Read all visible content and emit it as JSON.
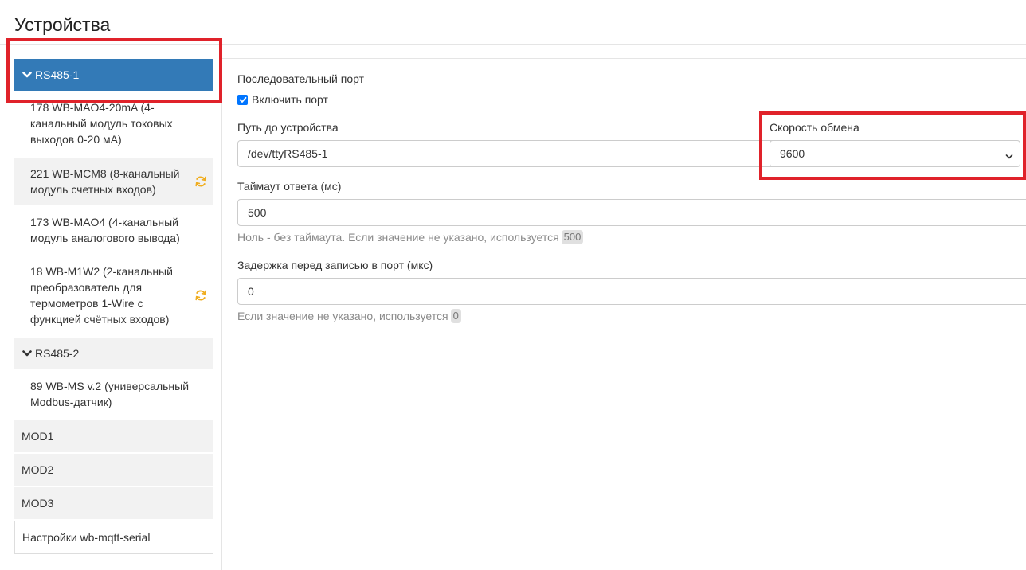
{
  "page": {
    "title": "Устройства"
  },
  "sidebar": {
    "ports": [
      {
        "label": "RS485-1",
        "active": true
      },
      {
        "label": "RS485-2",
        "active": false
      }
    ],
    "devices_rs485_1": [
      {
        "label": "178 WB-MAO4-20mA (4-канальный модуль токовых выходов 0-20 мА)",
        "sync": false
      },
      {
        "label": "221 WB-MCM8 (8-канальный модуль счетных входов)",
        "sync": true
      },
      {
        "label": "173 WB-MAO4 (4-канальный модуль аналогового вывода)",
        "sync": false
      },
      {
        "label": "18 WB-M1W2 (2-канальный преобразователь для термометров 1-Wire с функцией счётных входов)",
        "sync": true
      }
    ],
    "devices_rs485_2": [
      {
        "label": "89 WB-MS v.2 (универсальный Modbus-датчик)"
      }
    ],
    "mods": [
      "MOD1",
      "MOD2",
      "MOD3"
    ],
    "settings_label": "Настройки wb-mqtt-serial"
  },
  "form": {
    "section_title": "Последовательный порт",
    "enable_port": {
      "label": "Включить порт",
      "checked": true
    },
    "device_path": {
      "label": "Путь до устройства",
      "value": "/dev/ttyRS485-1"
    },
    "baud_rate": {
      "label": "Скорость обмена",
      "value": "9600"
    },
    "response_timeout": {
      "label": "Таймаут ответа (мс)",
      "value": "500",
      "help": "Ноль - без таймаута. Если значение не указано, используется",
      "default": "500"
    },
    "write_delay": {
      "label": "Задержка перед записью в порт (мкс)",
      "value": "0",
      "help": "Если значение не указано, используется",
      "default": "0"
    }
  },
  "colors": {
    "accent": "#337ab7",
    "highlight": "#e0222a",
    "sync_icon": "#f0ad1e",
    "checkbox": "#0075ff"
  },
  "icons": {
    "chevron": "chevron-down-icon",
    "sync": "sync-icon",
    "check": "check-icon",
    "select": "select-chevron-icon"
  }
}
